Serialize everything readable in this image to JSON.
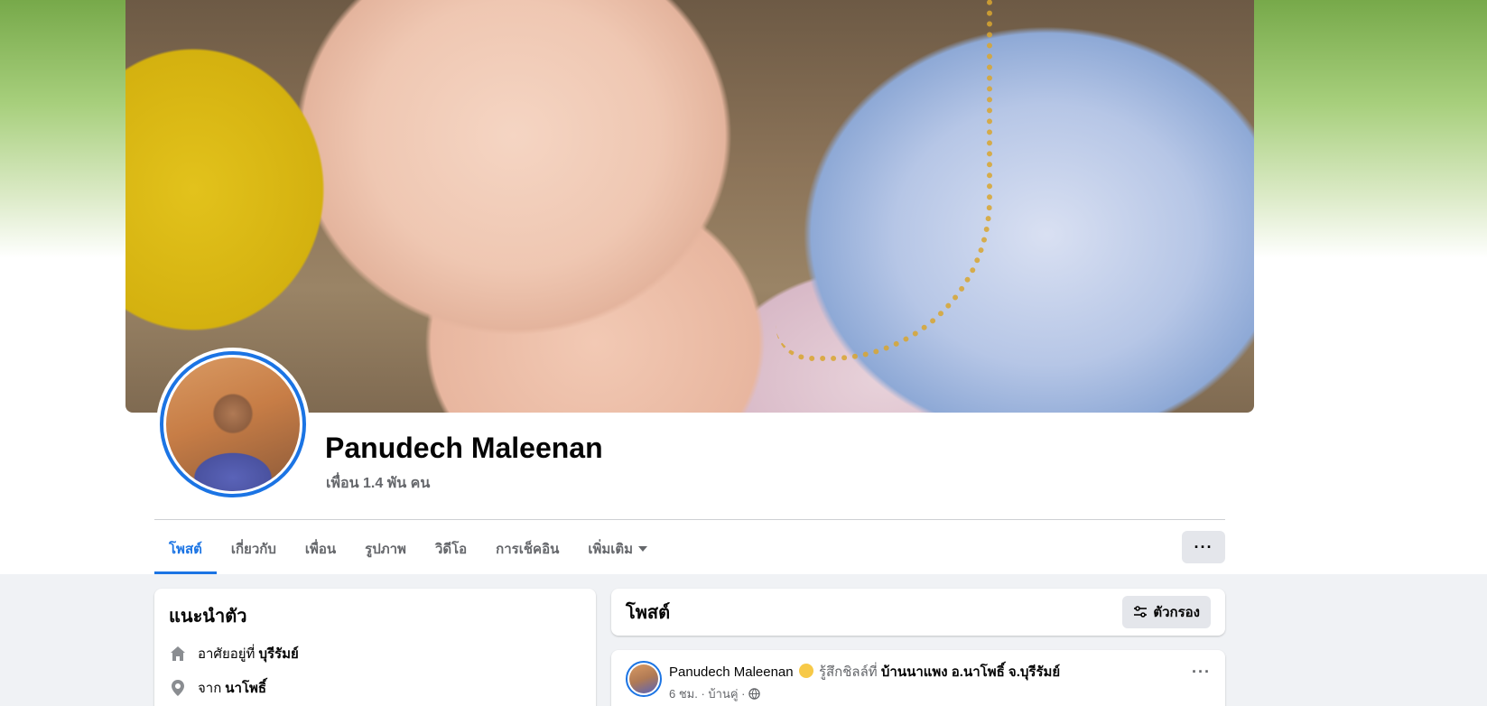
{
  "profile": {
    "name": "Panudech Maleenan",
    "friends": "เพื่อน 1.4 พัน คน"
  },
  "tabs": [
    {
      "label": "โพสต์"
    },
    {
      "label": "เกี่ยวกับ"
    },
    {
      "label": "เพื่อน"
    },
    {
      "label": "รูปภาพ"
    },
    {
      "label": "วิดีโอ"
    },
    {
      "label": "การเช็คอิน"
    },
    {
      "label": "เพิ่มเติม"
    }
  ],
  "more_button": "···",
  "intro": {
    "title": "แนะนำตัว",
    "lives_prefix": "อาศัยอยู่ที่",
    "lives_value": "บุรีรัมย์",
    "from_prefix": "จาก",
    "from_value": "นาโพธิ์"
  },
  "posts": {
    "title": "โพสต์",
    "filter_label": "ตัวกรอง"
  },
  "post": {
    "author": "Panudech Maleenan",
    "feeling": "รู้สึกชิลล์ที่",
    "place": "บ้านนาแพง อ.นาโพธิ์ จ.บุรีรัมย์",
    "time": "6 ชม. · บ้านคู่ ·",
    "menu": "···"
  },
  "colors": {
    "accent": "#1b74e4",
    "muted": "#65676b",
    "page_bg": "#f0f2f5"
  }
}
